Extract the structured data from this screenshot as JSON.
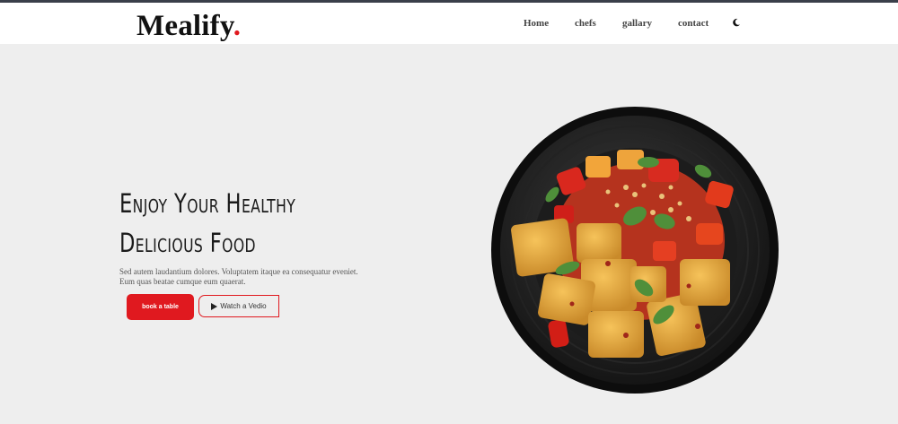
{
  "header": {
    "logo_text": "Mealify",
    "logo_dot": ".",
    "nav": [
      "Home",
      "chefs",
      "gallary",
      "contact"
    ],
    "theme_toggle_icon": "moon-icon"
  },
  "hero": {
    "title_line1": "Enjoy Your Healthy",
    "title_line2": "Delicious Food",
    "description": "Sed autem laudantium dolores. Voluptatem itaque ea consequatur eveniet. Eum quas beatae cumque eum quaerat.",
    "book_label": "book a table",
    "watch_label": "Watch a Vedio",
    "watch_icon": "play-icon",
    "image": "food-plate-image"
  },
  "colors": {
    "accent": "#e0191f",
    "background": "#eeeeee",
    "navbar": "#ffffff",
    "topline": "#3a3f4a"
  }
}
